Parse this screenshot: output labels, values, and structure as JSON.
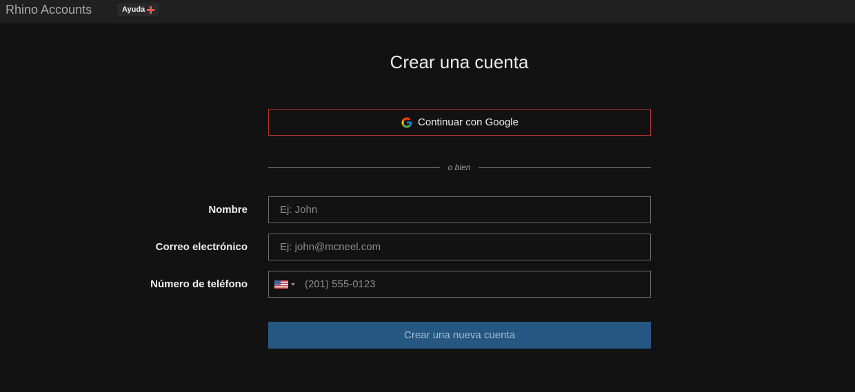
{
  "header": {
    "brand": "Rhino Accounts",
    "help_label": "Ayuda",
    "help_icon": "plus-icon",
    "help_icon_color": "#e35a52"
  },
  "page": {
    "title": "Crear una cuenta"
  },
  "google": {
    "label": "Continuar con Google",
    "icon": "google-icon",
    "border_color": "#b3332e"
  },
  "divider": {
    "text": "o bien"
  },
  "form": {
    "name": {
      "label": "Nombre",
      "placeholder": "Ej: John",
      "value": ""
    },
    "email": {
      "label": "Correo electrónico",
      "placeholder": "Ej: john@mcneel.com",
      "value": ""
    },
    "phone": {
      "label": "Número de teléfono",
      "placeholder": "(201) 555-0123",
      "value": "",
      "country_icon": "us-flag-icon"
    },
    "submit_label": "Crear una nueva cuenta",
    "submit_color": "#255782"
  }
}
